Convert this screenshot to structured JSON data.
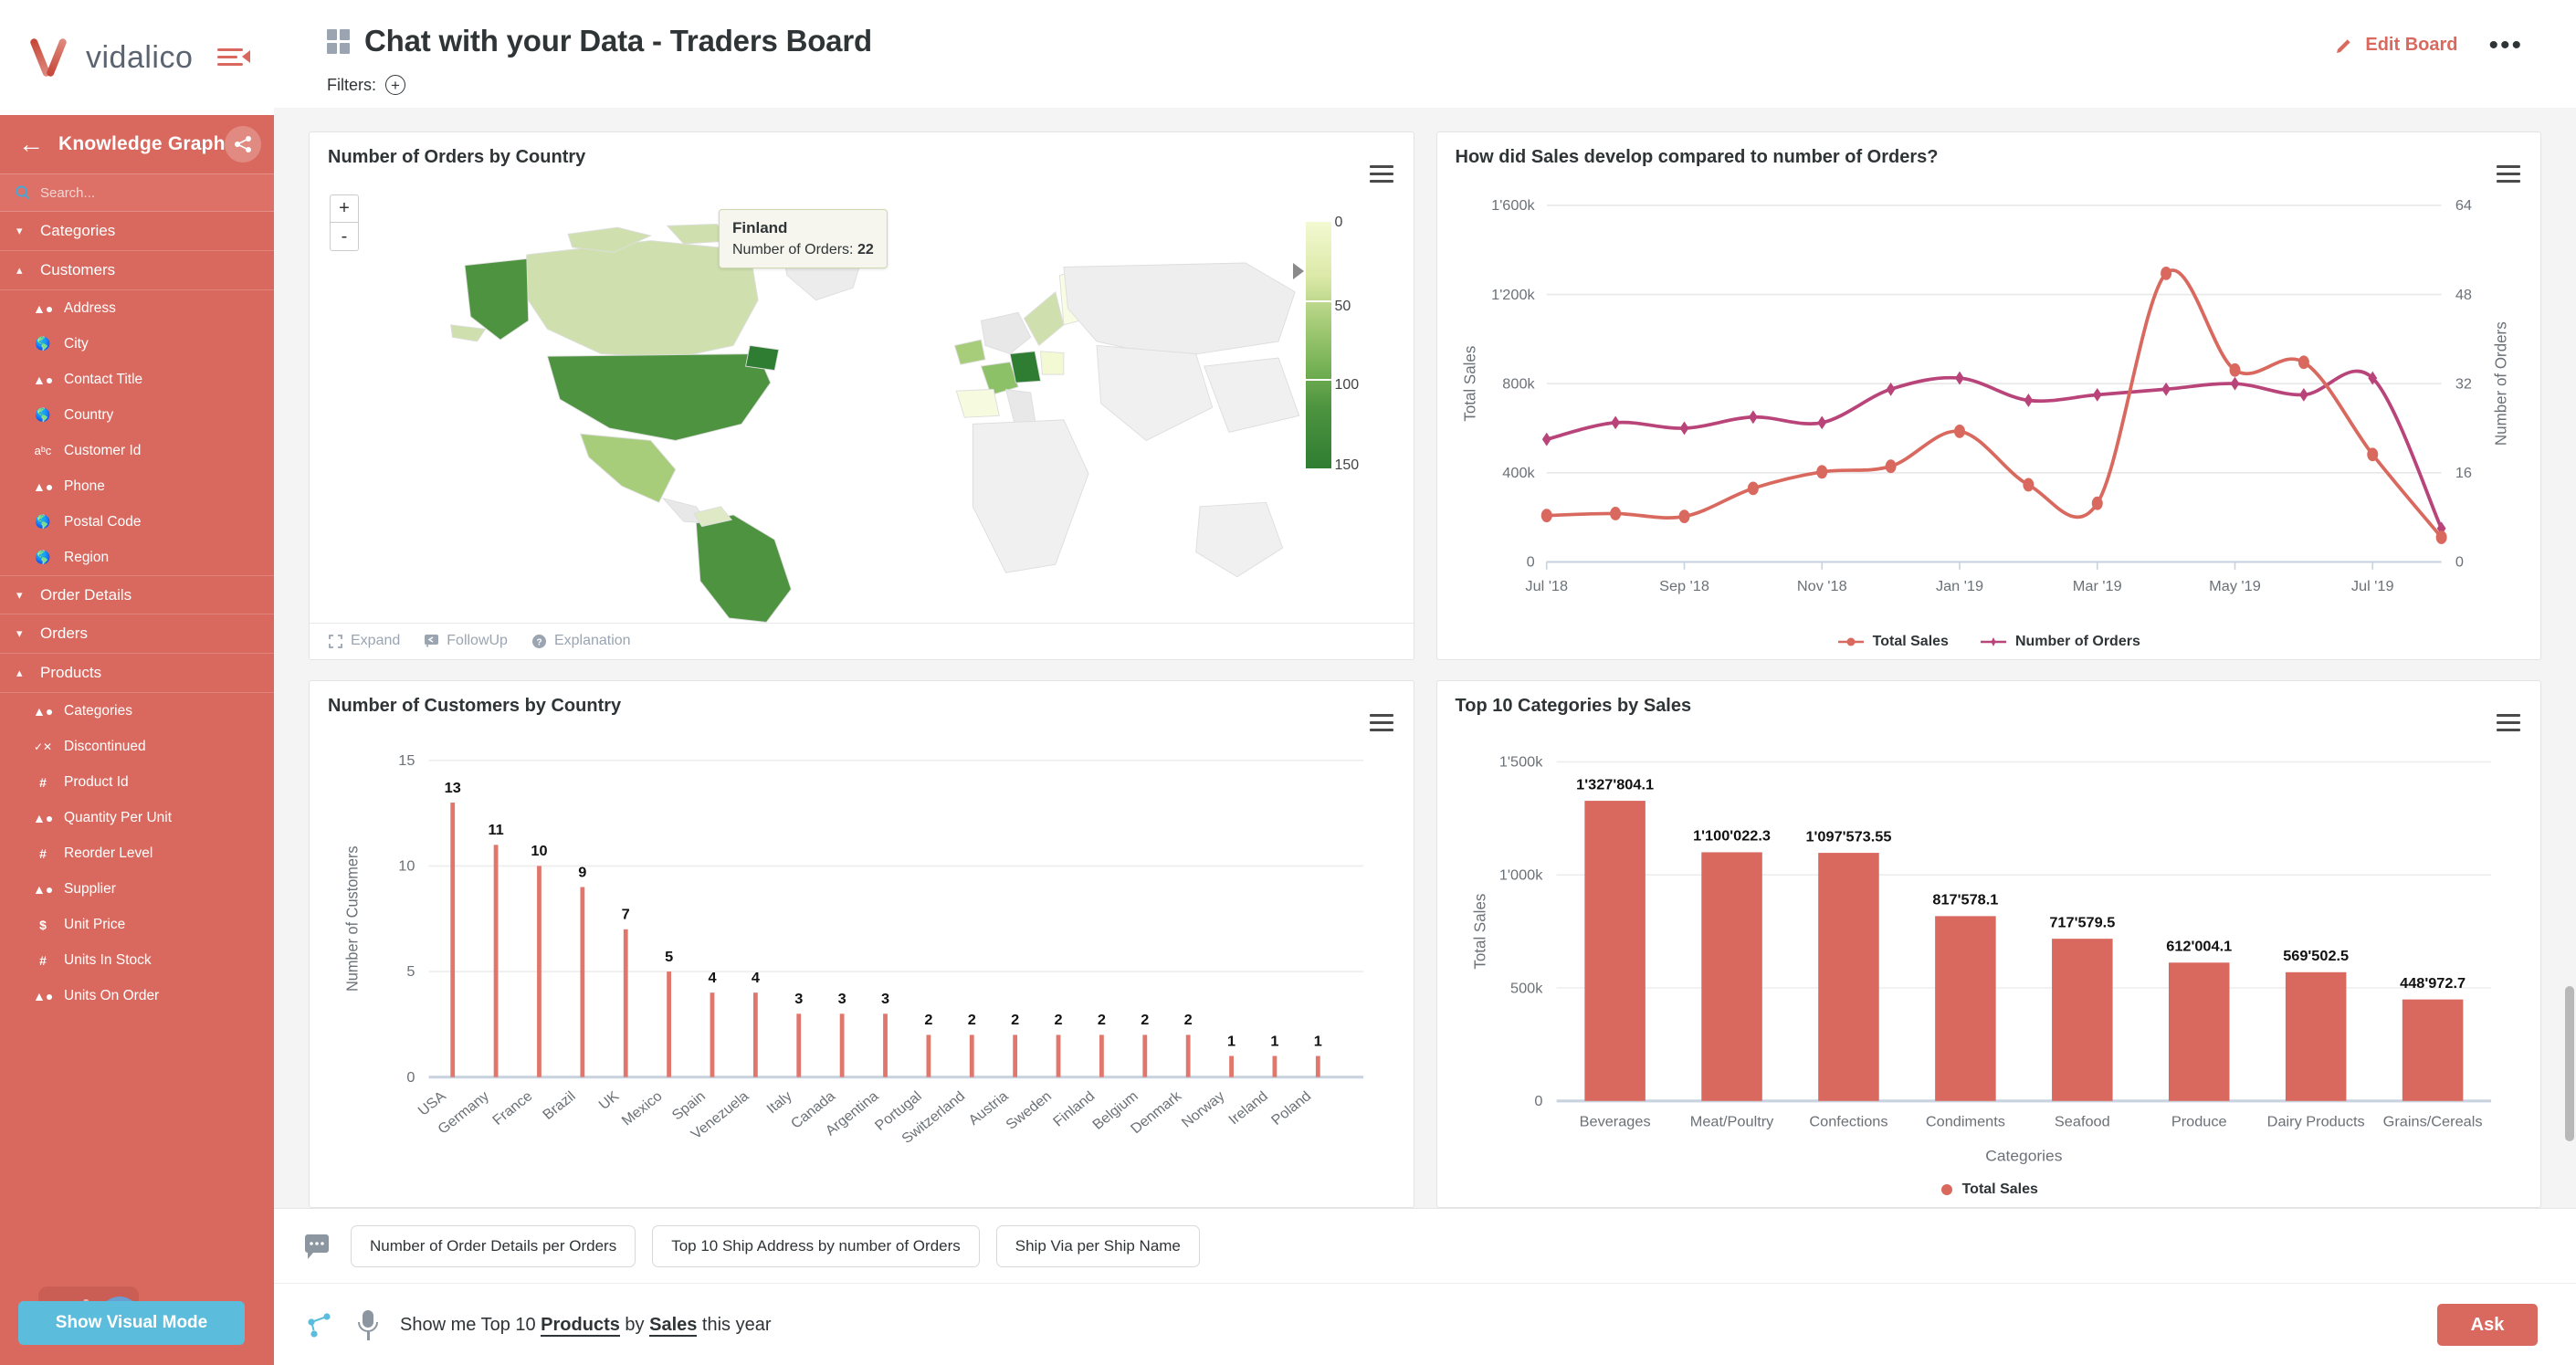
{
  "brand": {
    "name": "vidalico",
    "collapse_icon": "collapse-menu-icon"
  },
  "sidebar": {
    "header": {
      "title": "Knowledge Graph",
      "back_icon": "arrow-left-icon",
      "graph_icon": "knowledge-graph-icon"
    },
    "search": {
      "placeholder": "Search...",
      "value": "",
      "icon": "search-icon"
    },
    "groups": [
      {
        "label": "Categories",
        "expanded": false,
        "items": []
      },
      {
        "label": "Customers",
        "expanded": true,
        "items": [
          {
            "label": "Address",
            "icon": "shapes-icon"
          },
          {
            "label": "City",
            "icon": "globe-icon"
          },
          {
            "label": "Contact Title",
            "icon": "shapes-icon"
          },
          {
            "label": "Country",
            "icon": "globe-icon"
          },
          {
            "label": "Customer Id",
            "icon": "abc-icon"
          },
          {
            "label": "Phone",
            "icon": "shapes-icon"
          },
          {
            "label": "Postal Code",
            "icon": "globe-icon"
          },
          {
            "label": "Region",
            "icon": "globe-icon"
          }
        ]
      },
      {
        "label": "Order Details",
        "expanded": false,
        "items": []
      },
      {
        "label": "Orders",
        "expanded": false,
        "items": []
      },
      {
        "label": "Products",
        "expanded": true,
        "items": [
          {
            "label": "Categories",
            "icon": "shapes-icon"
          },
          {
            "label": "Discontinued",
            "icon": "check-cross-icon"
          },
          {
            "label": "Product Id",
            "icon": "hash-icon"
          },
          {
            "label": "Quantity Per Unit",
            "icon": "shapes-icon"
          },
          {
            "label": "Reorder Level",
            "icon": "hash-icon"
          },
          {
            "label": "Supplier",
            "icon": "shapes-icon"
          },
          {
            "label": "Unit Price",
            "icon": "dollar-icon"
          },
          {
            "label": "Units In Stock",
            "icon": "hash-icon"
          },
          {
            "label": "Units On Order",
            "icon": "shapes-icon"
          }
        ]
      }
    ],
    "visual_mode_button": "Show Visual Mode"
  },
  "header": {
    "board_title": "Chat with your Data - Traders Board",
    "grid_icon": "board-grid-icon",
    "edit_board": "Edit Board",
    "edit_icon": "pencil-icon",
    "more_icon": "more-options-icon",
    "filters_label": "Filters:",
    "filters_add_icon": "plus-circle-icon"
  },
  "panels": {
    "map": {
      "title": "Number of Orders by Country",
      "zoom_in": "+",
      "zoom_out": "-",
      "tooltip": {
        "country": "Finland",
        "metric_label": "Number of Orders:",
        "metric_value": "22"
      },
      "legend_ticks": [
        "0",
        "50",
        "100",
        "150"
      ],
      "footer": [
        {
          "label": "Expand",
          "icon": "expand-icon"
        },
        {
          "label": "FollowUp",
          "icon": "followup-icon"
        },
        {
          "label": "Explanation",
          "icon": "question-icon"
        }
      ],
      "menu_icon": "context-menu-icon"
    },
    "line": {
      "title": "How did Sales develop compared to number of Orders?",
      "menu_icon": "context-menu-icon"
    },
    "customers": {
      "title": "Number of Customers by Country",
      "menu_icon": "context-menu-icon"
    },
    "categories": {
      "title": "Top 10 Categories by Sales",
      "menu_icon": "context-menu-icon"
    }
  },
  "bottom": {
    "chat_icon": "chat-bubble-icon",
    "suggestions": [
      "Number of Order Details per Orders",
      "Top 10 Ship Address by number of Orders",
      "Ship Via per Ship Name"
    ],
    "kg_icon": "knowledge-graph-icon",
    "mic_icon": "microphone-icon",
    "question_parts": [
      {
        "text": "Show me Top 10 ",
        "bold": false
      },
      {
        "text": "Products",
        "bold": true
      },
      {
        "text": " by ",
        "bold": false
      },
      {
        "text": "Sales",
        "bold": true
      },
      {
        "text": " this year",
        "bold": false
      }
    ],
    "question_plain": "Show me Top 10 Products by Sales this year",
    "ask_button": "Ask"
  },
  "colors": {
    "brand": "#d9695f",
    "accent_blue": "#5bbcdc",
    "series_total_sales": "#d9695f",
    "series_number_of_orders": "#b8447a",
    "bar": "#d9695f"
  },
  "chart_data": [
    {
      "id": "orders_by_country_map",
      "type": "heatmap",
      "title": "Number of Orders by Country",
      "legend_ticks": [
        0,
        50,
        100,
        150
      ],
      "colorscale": [
        "#f3f9d2",
        "#a8cd7a",
        "#4e9440",
        "#2f7d32"
      ],
      "highlight": {
        "country": "Finland",
        "value": 22
      },
      "countries": [
        {
          "name": "USA",
          "value": 122
        },
        {
          "name": "Germany",
          "value": 150
        },
        {
          "name": "Brazil",
          "value": 83
        },
        {
          "name": "France",
          "value": 77
        },
        {
          "name": "UK",
          "value": 56
        },
        {
          "name": "Venezuela",
          "value": 46
        },
        {
          "name": "Canada",
          "value": 30
        },
        {
          "name": "Finland",
          "value": 22
        },
        {
          "name": "Sweden",
          "value": 37
        },
        {
          "name": "Austria",
          "value": 40
        },
        {
          "name": "Mexico",
          "value": 28
        },
        {
          "name": "Spain",
          "value": 23
        },
        {
          "name": "Italy",
          "value": 28
        },
        {
          "name": "Argentina",
          "value": 16
        },
        {
          "name": "Portugal",
          "value": 13
        },
        {
          "name": "Switzerland",
          "value": 18
        },
        {
          "name": "Belgium",
          "value": 19
        },
        {
          "name": "Denmark",
          "value": 18
        },
        {
          "name": "Norway",
          "value": 6
        },
        {
          "name": "Ireland",
          "value": 19
        },
        {
          "name": "Poland",
          "value": 7
        }
      ]
    },
    {
      "id": "sales_vs_orders",
      "type": "line",
      "title": "How did Sales develop compared to number of Orders?",
      "xlabel": "",
      "ylabel": "Total Sales",
      "y2label": "Number of Orders",
      "ylim": [
        0,
        1600000
      ],
      "y2lim": [
        0,
        64
      ],
      "yticks": [
        "0",
        "400k",
        "800k",
        "1'200k",
        "1'600k"
      ],
      "y2ticks": [
        "0",
        "16",
        "32",
        "48",
        "64"
      ],
      "xticks": [
        "Jul '18",
        "Sep '18",
        "Nov '18",
        "Jan '19",
        "Mar '19",
        "May '19",
        "Jul '19"
      ],
      "x": [
        "Jul '18",
        "Aug '18",
        "Sep '18",
        "Oct '18",
        "Nov '18",
        "Dec '18",
        "Jan '19",
        "Feb '19",
        "Mar '19",
        "Apr '19",
        "May '19",
        "Jun '19",
        "Jul '19",
        "Aug '19"
      ],
      "grid": true,
      "legend_position": "bottom",
      "series": [
        {
          "name": "Total Sales",
          "color": "#d9695f",
          "axis": "left",
          "values": [
            208000,
            217000,
            204000,
            330000,
            404000,
            429000,
            586000,
            346000,
            263000,
            1295000,
            861000,
            896000,
            482000,
            110000
          ]
        },
        {
          "name": "Number of Orders",
          "color": "#b8447a",
          "axis": "right",
          "values": [
            22,
            25,
            24,
            26,
            25,
            31,
            33,
            29,
            30,
            31,
            32,
            30,
            33,
            6
          ]
        }
      ]
    },
    {
      "id": "customers_by_country",
      "type": "bar",
      "title": "Number of Customers by Country",
      "xlabel": "",
      "ylabel": "Number of Customers",
      "ylim": [
        0,
        15
      ],
      "yticks": [
        "0",
        "5",
        "10",
        "15"
      ],
      "categories": [
        "USA",
        "Germany",
        "France",
        "Brazil",
        "UK",
        "Mexico",
        "Spain",
        "Venezuela",
        "Italy",
        "Canada",
        "Argentina",
        "Portugal",
        "Switzerland",
        "Austria",
        "Sweden",
        "Finland",
        "Belgium",
        "Denmark",
        "Norway",
        "Ireland",
        "Poland"
      ],
      "values": [
        13,
        11,
        10,
        9,
        7,
        5,
        4,
        4,
        3,
        3,
        3,
        2,
        2,
        2,
        2,
        2,
        2,
        2,
        1,
        1,
        1
      ],
      "data_labels": [
        "13",
        "11",
        "10",
        "9",
        "7",
        "5",
        "4",
        "4",
        "3",
        "3",
        "3",
        "2",
        "2",
        "2",
        "2",
        "2",
        "2",
        "2",
        "1",
        "1",
        "1"
      ],
      "color": "#e0766c"
    },
    {
      "id": "top10_categories_by_sales",
      "type": "bar",
      "title": "Top 10 Categories by Sales",
      "xlabel": "Categories",
      "ylabel": "Total Sales",
      "ylim": [
        0,
        1500000
      ],
      "yticks": [
        "0",
        "500k",
        "1'000k",
        "1'500k"
      ],
      "categories": [
        "Beverages",
        "Meat/Poultry",
        "Confections",
        "Condiments",
        "Seafood",
        "Produce",
        "Dairy Products",
        "Grains/Cereals"
      ],
      "values": [
        1327804.1,
        1100022.3,
        1097573.55,
        817578.1,
        717579.5,
        612004.1,
        569502.5,
        448972.7
      ],
      "data_labels": [
        "1'327'804.1",
        "1'100'022.3",
        "1'097'573.55",
        "817'578.1",
        "717'579.5",
        "612'004.1",
        "569'502.5",
        "448'972.7"
      ],
      "legend": [
        {
          "name": "Total Sales",
          "color": "#d9695f"
        }
      ],
      "legend_position": "bottom",
      "color": "#d9695f"
    }
  ]
}
